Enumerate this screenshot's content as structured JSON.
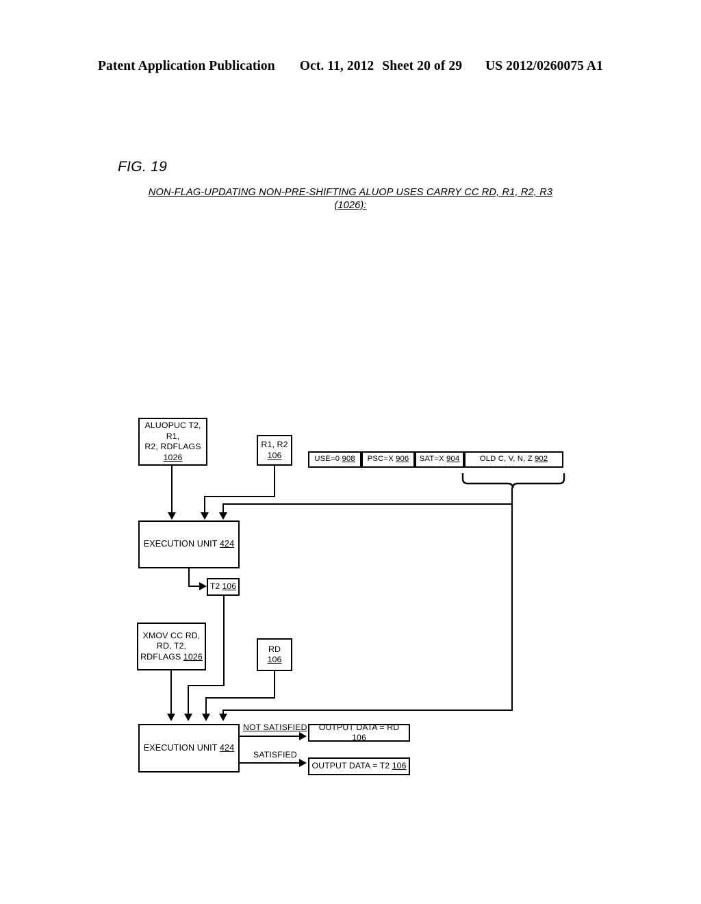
{
  "header": {
    "publication": "Patent Application Publication",
    "date": "Oct. 11, 2012",
    "sheet": "Sheet 20 of 29",
    "patent_number": "US 2012/0260075 A1"
  },
  "figure": {
    "label": "FIG. 19",
    "title_line1": "NON-FLAG-UPDATING NON-PRE-SHIFTING ALUOP USES CARRY CC RD, R1, R2, R3",
    "title_line2": "(1026):"
  },
  "diagram": {
    "aluopuc_box": {
      "text": "ALUOPUC T2, R1,\nR2, RDFLAGS\n",
      "ref": "1026"
    },
    "r1r2_box": {
      "text": "R1, R2\n",
      "ref": "106"
    },
    "flags_row": [
      {
        "label": "USE=0",
        "ref": "908"
      },
      {
        "label": "PSC=X",
        "ref": "906"
      },
      {
        "label": "SAT=X",
        "ref": "904"
      },
      {
        "label": "OLD C, V, N, Z",
        "ref": "902"
      }
    ],
    "exec_unit_1": {
      "text": "EXECUTION UNIT ",
      "ref": "424"
    },
    "t2_box": {
      "text": "T2 ",
      "ref": "106"
    },
    "xmov_box": {
      "text": "XMOV CC RD,\nRD, T2,\nRDFLAGS  ",
      "ref": "1026"
    },
    "rd_box": {
      "text": "RD ",
      "ref": "106"
    },
    "exec_unit_2": {
      "text": "EXECUTION UNIT ",
      "ref": "424"
    },
    "edge_not_satisfied": "NOT SATISFIED",
    "edge_satisfied": "SATISFIED",
    "output_rd_box": {
      "text": "OUTPUT DATA = RD ",
      "ref": "106"
    },
    "output_t2_box": {
      "text": "OUTPUT DATA = T2 ",
      "ref": "106"
    }
  },
  "colors": {
    "ink": "#000000",
    "paper": "#ffffff"
  }
}
